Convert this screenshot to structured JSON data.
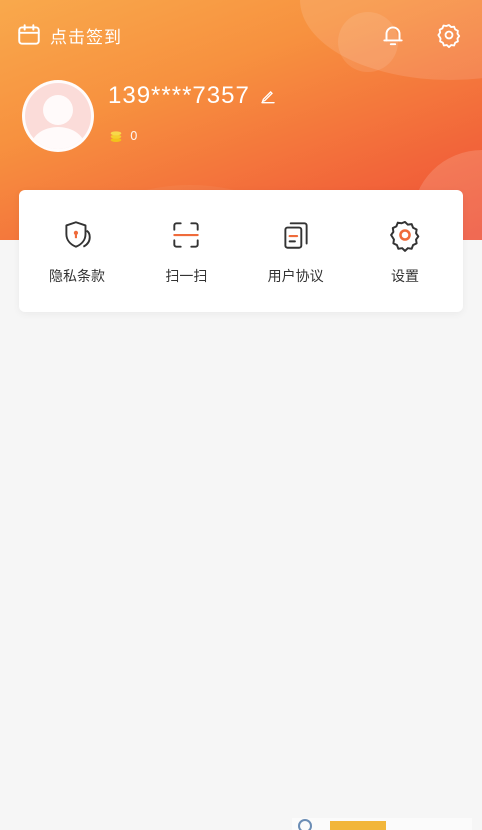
{
  "header": {
    "checkin_label": "点击签到",
    "bell_icon": "bell-icon",
    "settings_icon": "gear-icon"
  },
  "user": {
    "phone": "139****7357",
    "coins": "0"
  },
  "menu": {
    "items": [
      {
        "label": "隐私条款",
        "icon": "shield-icon"
      },
      {
        "label": "扫一扫",
        "icon": "scan-icon"
      },
      {
        "label": "用户协议",
        "icon": "document-icon"
      },
      {
        "label": "设置",
        "icon": "gear-icon"
      }
    ]
  },
  "colors": {
    "gradient_start": "#f9a94c",
    "gradient_end": "#ee4f35",
    "accent": "#ef6b3b",
    "text": "#333333",
    "background": "#f6f6f6"
  }
}
